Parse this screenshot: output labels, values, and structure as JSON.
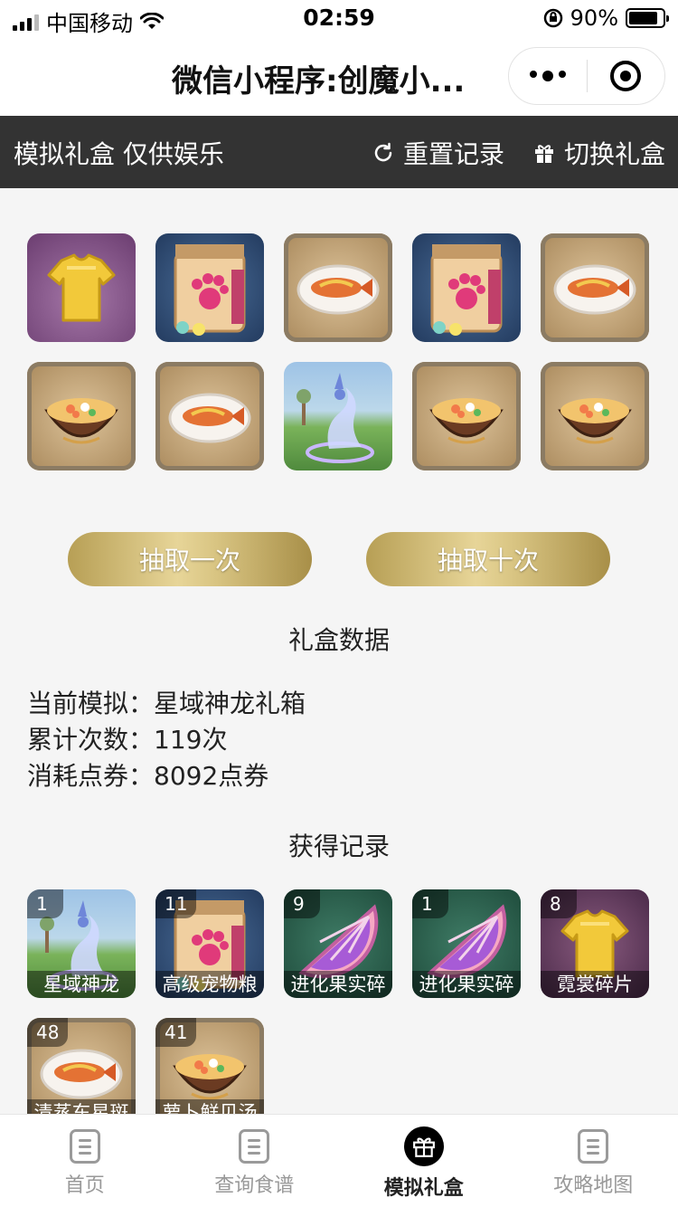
{
  "status_bar": {
    "carrier": "中国移动",
    "time": "02:59",
    "battery": "90%"
  },
  "nav": {
    "title": "微信小程序:创魔小..."
  },
  "toolbar": {
    "title": "模拟礼盒 仅供娱乐",
    "reset_label": "重置记录",
    "switch_label": "切换礼盒"
  },
  "draw_results": [
    {
      "icon": "shirt-icon",
      "bg": "purple"
    },
    {
      "icon": "pet-food-bag-icon",
      "bg": "blue"
    },
    {
      "icon": "fish-dish-icon",
      "bg": "wood"
    },
    {
      "icon": "pet-food-bag-icon",
      "bg": "blue"
    },
    {
      "icon": "fish-dish-icon",
      "bg": "wood"
    },
    {
      "icon": "soup-bowl-icon",
      "bg": "wood"
    },
    {
      "icon": "fish-dish-icon",
      "bg": "wood"
    },
    {
      "icon": "dragon-mount-icon",
      "bg": "scene"
    },
    {
      "icon": "soup-bowl-icon",
      "bg": "wood"
    },
    {
      "icon": "soup-bowl-icon",
      "bg": "wood"
    }
  ],
  "buttons": {
    "draw_once": "抽取一次",
    "draw_ten": "抽取十次"
  },
  "stats": {
    "title": "礼盒数据",
    "current_label": "当前模拟：",
    "current_value": "星域神龙礼箱",
    "count_label": "累计次数：",
    "count_value": "119次",
    "cost_label": "消耗点券：",
    "cost_value": "8092点券"
  },
  "records": {
    "title": "获得记录",
    "items": [
      {
        "count": "1",
        "name": "星域神龙",
        "icon": "dragon-mount-icon",
        "bg": "scene"
      },
      {
        "count": "11",
        "name": "高级宠物粮",
        "icon": "pet-food-bag-icon",
        "bg": "blue"
      },
      {
        "count": "9",
        "name": "进化果实碎",
        "icon": "fruit-slice-icon",
        "bg": "green"
      },
      {
        "count": "1",
        "name": "进化果实碎",
        "icon": "fruit-slice-icon",
        "bg": "green"
      },
      {
        "count": "8",
        "name": "霓裳碎片",
        "icon": "shirt-icon",
        "bg": "purple2"
      },
      {
        "count": "48",
        "name": "清蒸东星斑",
        "icon": "fish-dish-icon",
        "bg": "wood"
      },
      {
        "count": "41",
        "name": "萝卜鲜贝汤",
        "icon": "soup-bowl-icon",
        "bg": "wood"
      }
    ]
  },
  "tabbar": {
    "items": [
      {
        "label": "首页",
        "icon": "document-icon",
        "active": false
      },
      {
        "label": "查询食谱",
        "icon": "document-icon",
        "active": false
      },
      {
        "label": "模拟礼盒",
        "icon": "gift-icon",
        "active": true
      },
      {
        "label": "攻略地图",
        "icon": "document-icon",
        "active": false
      }
    ]
  }
}
